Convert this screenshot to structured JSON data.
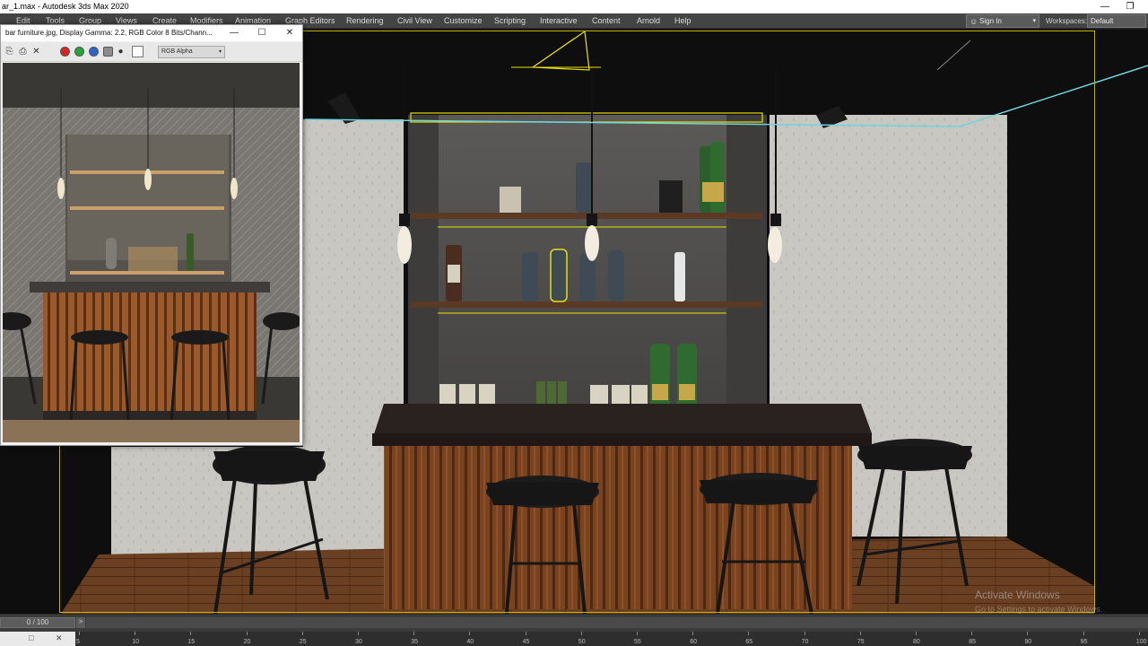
{
  "window": {
    "title": "ar_1.max - Autodesk 3ds Max 2020",
    "minimize_glyph": "—",
    "restore_glyph": "❐"
  },
  "menu": {
    "items": [
      "Edit",
      "Tools",
      "Group",
      "Views",
      "Create",
      "Modifiers",
      "Animation",
      "Graph Editors",
      "Rendering",
      "Civil View",
      "Customize",
      "Scripting",
      "Interactive",
      "Content",
      "Arnold",
      "Help"
    ],
    "sign_in": "Sign In",
    "workspaces_label": "Workspaces:",
    "workspace_value": "Default"
  },
  "frame_buffer": {
    "title": "bar furniture.jpg, Display Gamma: 2.2, RGB Color 8 Bits/Chann...",
    "channel_select": "RGB Alpha",
    "channel_colors": [
      "#d42424",
      "#27a23f",
      "#2e63c9",
      "#8c8c8c"
    ],
    "controls": {
      "minimize": "—",
      "maximize": "☐",
      "close": "✕"
    }
  },
  "watermark": {
    "title": "Activate Windows",
    "subtitle": "Go to Settings to activate Windows."
  },
  "timeline": {
    "frame_display": "0 / 100",
    "next_glyph": ">",
    "ruler_labels": [
      "5",
      "10",
      "15",
      "20",
      "25",
      "30",
      "35",
      "40",
      "45",
      "50",
      "55",
      "60",
      "65",
      "70",
      "75",
      "80",
      "85",
      "90",
      "95",
      "100"
    ]
  },
  "colors": {
    "ui_dark": "#444444",
    "safe_frame": "#c9b400",
    "selection": "#e8e000",
    "wall": "#c8c6c0",
    "wood": "#7a4320",
    "countertop": "#2a221f"
  }
}
